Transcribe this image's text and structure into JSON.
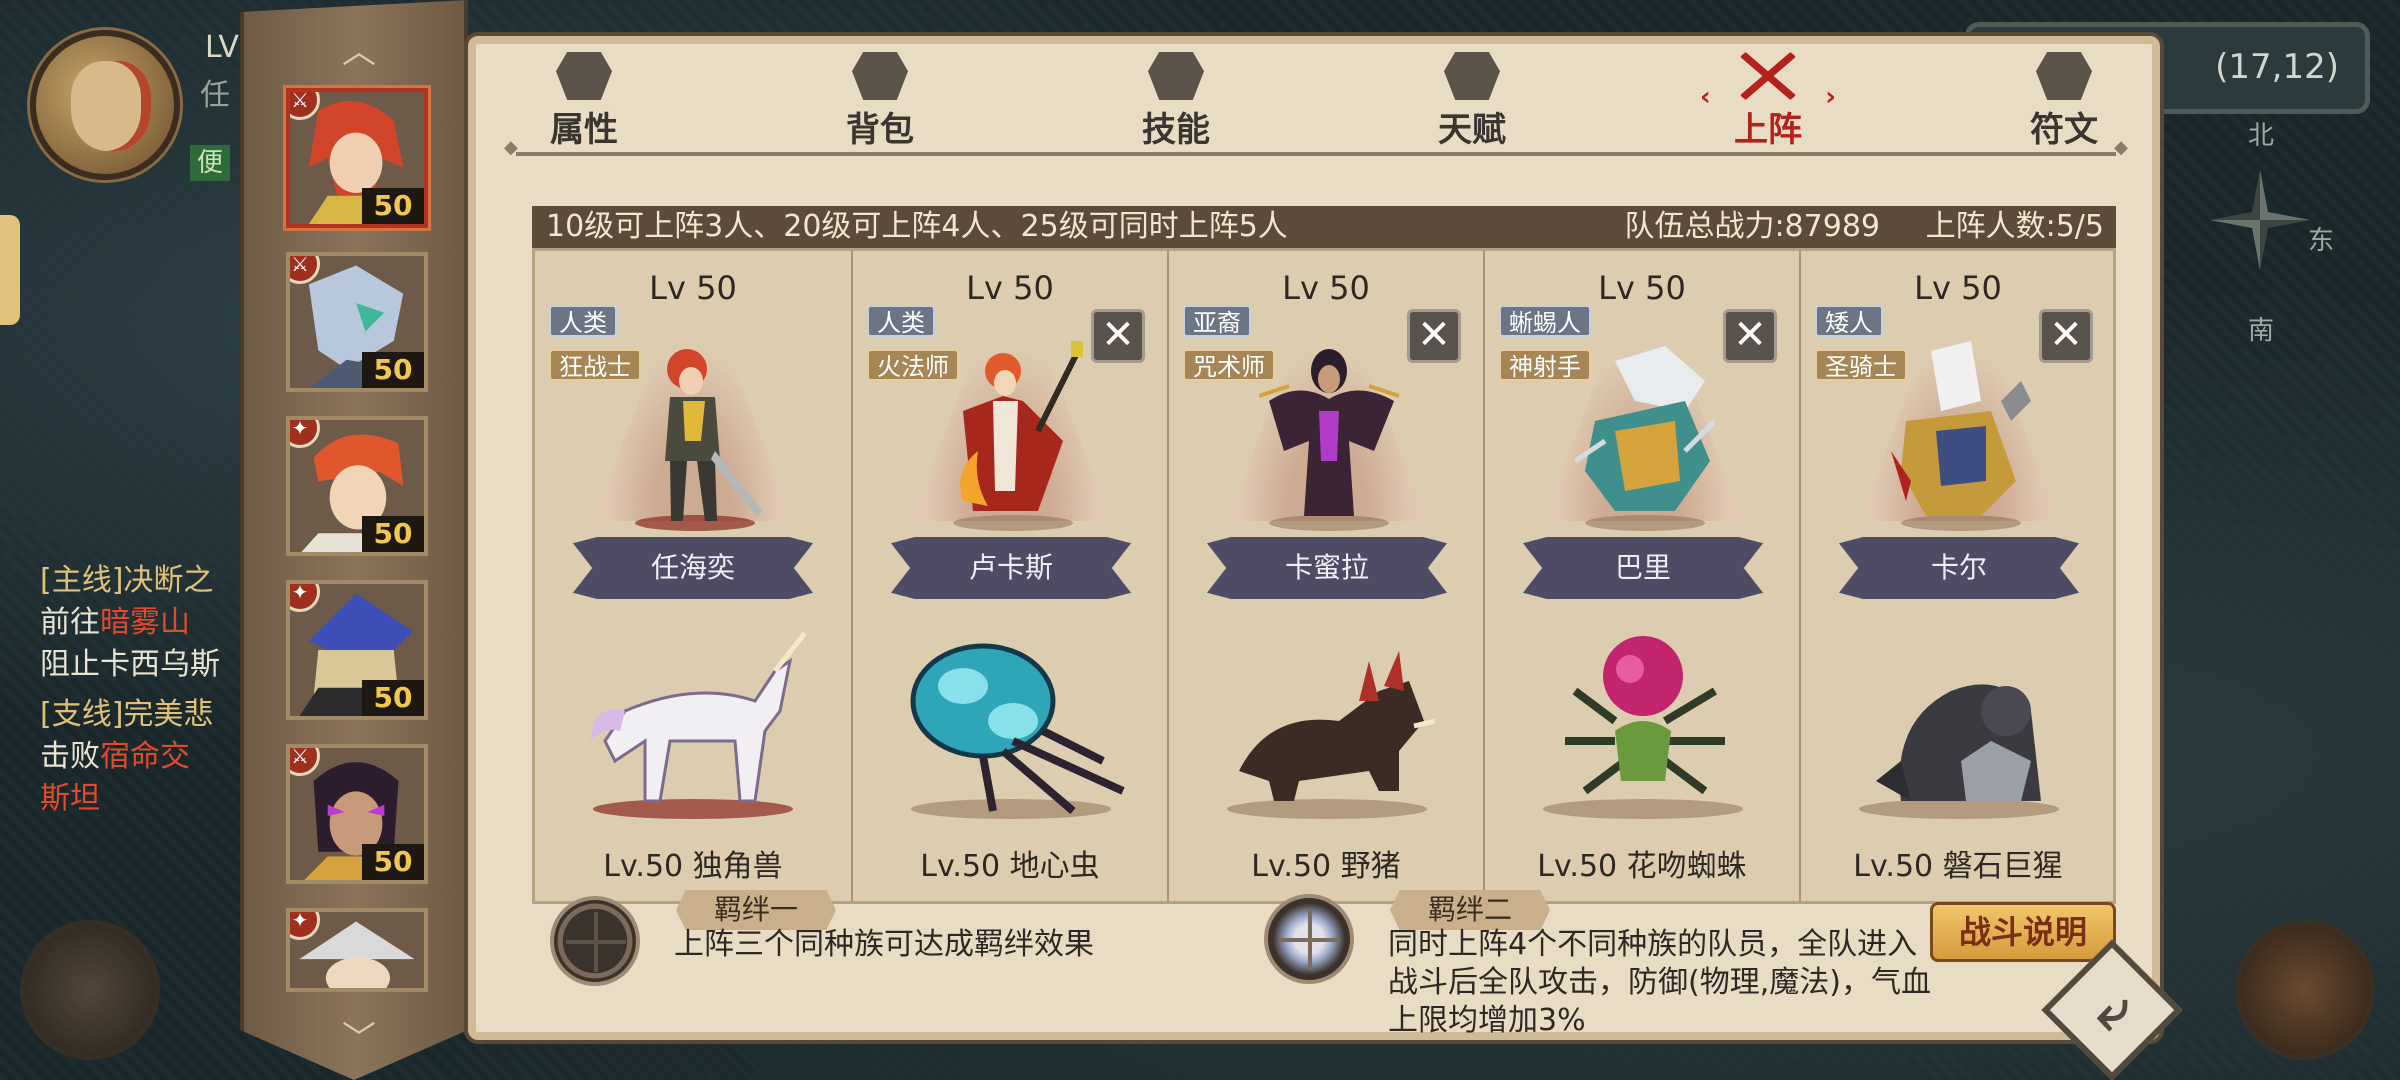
{
  "hud": {
    "level_prefix": "LV",
    "task_char": "任",
    "green_char": "便",
    "coords": "(17,12)",
    "compass": {
      "north": "北",
      "south": "南",
      "east": "东",
      "west": ""
    }
  },
  "quests": [
    {
      "tag": "[主线]决断之",
      "line1": "前往",
      "line1_red": "暗雾山",
      "line2": "阻止卡西乌斯"
    },
    {
      "tag": "[支线]完美悲",
      "line1": "击败",
      "line1_red": "宿命交",
      "line2_red": "斯坦"
    }
  ],
  "sidebar": {
    "portraits": [
      {
        "level": "50",
        "class_icon": "sword-icon",
        "selected": true
      },
      {
        "level": "50",
        "class_icon": "sword-icon",
        "selected": false
      },
      {
        "level": "50",
        "class_icon": "staff-icon",
        "selected": false
      },
      {
        "level": "50",
        "class_icon": "staff-icon",
        "selected": false
      },
      {
        "level": "50",
        "class_icon": "sword-icon",
        "selected": false
      },
      {
        "level": "",
        "class_icon": "staff-icon",
        "selected": false
      }
    ]
  },
  "tabs": [
    {
      "label": "属性",
      "icon": "attributes-icon"
    },
    {
      "label": "背包",
      "icon": "backpack-icon"
    },
    {
      "label": "技能",
      "icon": "skill-book-icon"
    },
    {
      "label": "天赋",
      "icon": "talent-icon"
    },
    {
      "label": "上阵",
      "icon": "crossed-swords-icon",
      "active": true
    },
    {
      "label": "符文",
      "icon": "rune-icon"
    }
  ],
  "info_bar": {
    "rule": "10级可上阵3人、20级可上阵4人、25级可同时上阵5人",
    "team_power": "队伍总战力:87989",
    "team_count": "上阵人数:5/5"
  },
  "roster": [
    {
      "level": "Lv 50",
      "race": "人类",
      "job": "狂战士",
      "name": "任海奕",
      "removable": false,
      "pet": "Lv.50 独角兽"
    },
    {
      "level": "Lv 50",
      "race": "人类",
      "job": "火法师",
      "name": "卢卡斯",
      "removable": true,
      "pet": "Lv.50 地心虫"
    },
    {
      "level": "Lv 50",
      "race": "亚裔",
      "job": "咒术师",
      "name": "卡蜜拉",
      "removable": true,
      "pet": "Lv.50 野猪"
    },
    {
      "level": "Lv 50",
      "race": "蜥蜴人",
      "job": "神射手",
      "name": "巴里",
      "removable": true,
      "pet": "Lv.50 花吻蜘蛛"
    },
    {
      "level": "Lv 50",
      "race": "矮人",
      "job": "圣骑士",
      "name": "卡尔",
      "removable": true,
      "pet": "Lv.50 磐石巨猩"
    }
  ],
  "bonds": [
    {
      "title": "羁绊一",
      "desc": [
        "上阵三个同种族可达成羁绊效果"
      ],
      "lit": false
    },
    {
      "title": "羁绊二",
      "desc": [
        "同时上阵4个不同种族的队员，全队进入",
        "战斗后全队攻击，防御(物理,魔法)，气血",
        "上限均增加3%"
      ],
      "lit": true
    }
  ],
  "buttons": {
    "battle_help": "战斗说明",
    "back": "⤶",
    "remove": "✕"
  },
  "colors": {
    "accent_red": "#b3221c",
    "panel": "#e9dcc4",
    "level_gold": "#f1c84c",
    "race_tag": "#6b7586",
    "job_tag": "#a78656"
  }
}
